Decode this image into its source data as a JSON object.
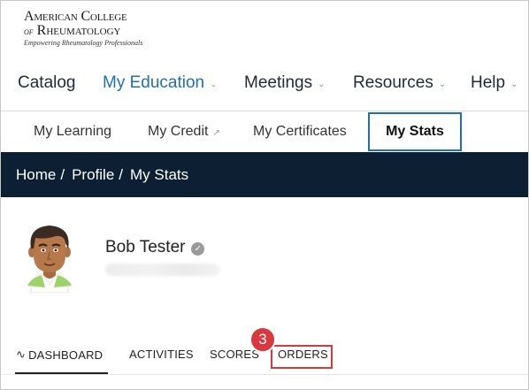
{
  "logo": {
    "line1": "American College",
    "line2_of": "of",
    "line2": "Rheumatology",
    "tagline": "Empowering Rheumatology Professionals"
  },
  "main_nav": [
    {
      "label": "Catalog",
      "active": false,
      "dropdown": false
    },
    {
      "label": "My Education",
      "active": true,
      "dropdown": true
    },
    {
      "label": "Meetings",
      "active": false,
      "dropdown": true
    },
    {
      "label": "Resources",
      "active": false,
      "dropdown": true
    },
    {
      "label": "Help",
      "active": false,
      "dropdown": true
    }
  ],
  "sub_nav": [
    {
      "label": "My Learning",
      "active": false,
      "external": false
    },
    {
      "label": "My Credit",
      "active": false,
      "external": true
    },
    {
      "label": "My Certificates",
      "active": false,
      "external": false
    },
    {
      "label": "My Stats",
      "active": true,
      "external": false
    }
  ],
  "breadcrumb": [
    {
      "label": "Home"
    },
    {
      "label": "Profile"
    },
    {
      "label": "My Stats"
    }
  ],
  "breadcrumb_separator": "/",
  "profile": {
    "name": "Bob Tester",
    "verified_icon": "check-circle-icon"
  },
  "tabs": [
    {
      "label": "DASHBOARD",
      "active": true,
      "icon": "pulse-icon"
    },
    {
      "label": "ACTIVITIES",
      "active": false
    },
    {
      "label": "SCORES",
      "active": false
    },
    {
      "label": "ORDERS",
      "active": false,
      "highlighted": true
    }
  ],
  "annotation": {
    "step_number": "3"
  },
  "colors": {
    "accent": "#1f6fb2",
    "breadcrumb_bg": "#0d1f33",
    "annotation_red": "#d9383e"
  }
}
